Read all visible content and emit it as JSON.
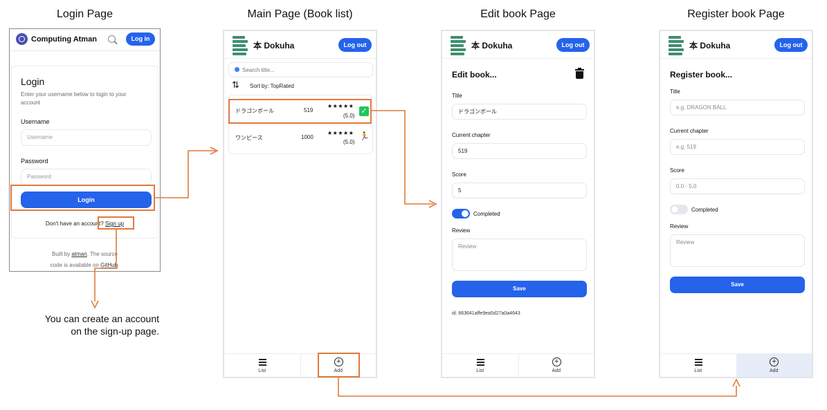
{
  "captions": {
    "login": "Login Page",
    "main": "Main Page (Book list)",
    "edit": "Edit book Page",
    "register": "Register book Page"
  },
  "login_page": {
    "brand": "Computing Atman",
    "login_pill": "Log in",
    "title": "Login",
    "subtitle": "Enter your username below to login to your account",
    "username_label": "Username",
    "username_placeholder": "Username",
    "password_label": "Password",
    "password_placeholder": "Password",
    "login_button": "Login",
    "signup_prompt": "Don't have an account?",
    "signup_link": "Sign up",
    "footer_line1_pre": "Built by ",
    "footer_author": "atman",
    "footer_line1_post": ". The source",
    "footer_line2_pre": "code is available on ",
    "footer_github": "GitHub",
    "footer_line2_post": "."
  },
  "note": {
    "line1": "You can create an account",
    "line2": "on the sign-up page."
  },
  "app": {
    "title": "本 Dokuha",
    "logout": "Log out",
    "tab_list": "List",
    "tab_add": "Add"
  },
  "main_page": {
    "search_placeholder": "Search title...",
    "sort_label": "Sort by: TopRated",
    "books": [
      {
        "title": "ドラゴンボール",
        "chapter": "519",
        "stars": "★★★★★",
        "score": "(5.0)",
        "status": "completed"
      },
      {
        "title": "ワンピース",
        "chapter": "1000",
        "stars": "★★★★★",
        "score": "(5.0)",
        "status": "running"
      }
    ]
  },
  "edit_page": {
    "heading": "Edit book...",
    "title_label": "Title",
    "title_value": "ドラゴンボール",
    "chapter_label": "Current chapter",
    "chapter_value": "519",
    "score_label": "Score",
    "score_value": "5",
    "completed_label": "Completed",
    "completed": true,
    "review_label": "Review",
    "review_placeholder": "Review",
    "save": "Save",
    "id_text": "id: 663641affe9ea5d27a0a4643"
  },
  "register_page": {
    "heading": "Register book...",
    "title_label": "Title",
    "title_placeholder": "e.g. DRAGON BALL",
    "chapter_label": "Current chapter",
    "chapter_placeholder": "e.g. 519",
    "score_label": "Score",
    "score_placeholder": "0.0 - 5.0",
    "completed_label": "Completed",
    "completed": false,
    "review_label": "Review",
    "review_placeholder": "Review",
    "save": "Save"
  },
  "colors": {
    "accent": "#2563eb",
    "highlight": "#e07a3a",
    "check": "#22c55e"
  }
}
